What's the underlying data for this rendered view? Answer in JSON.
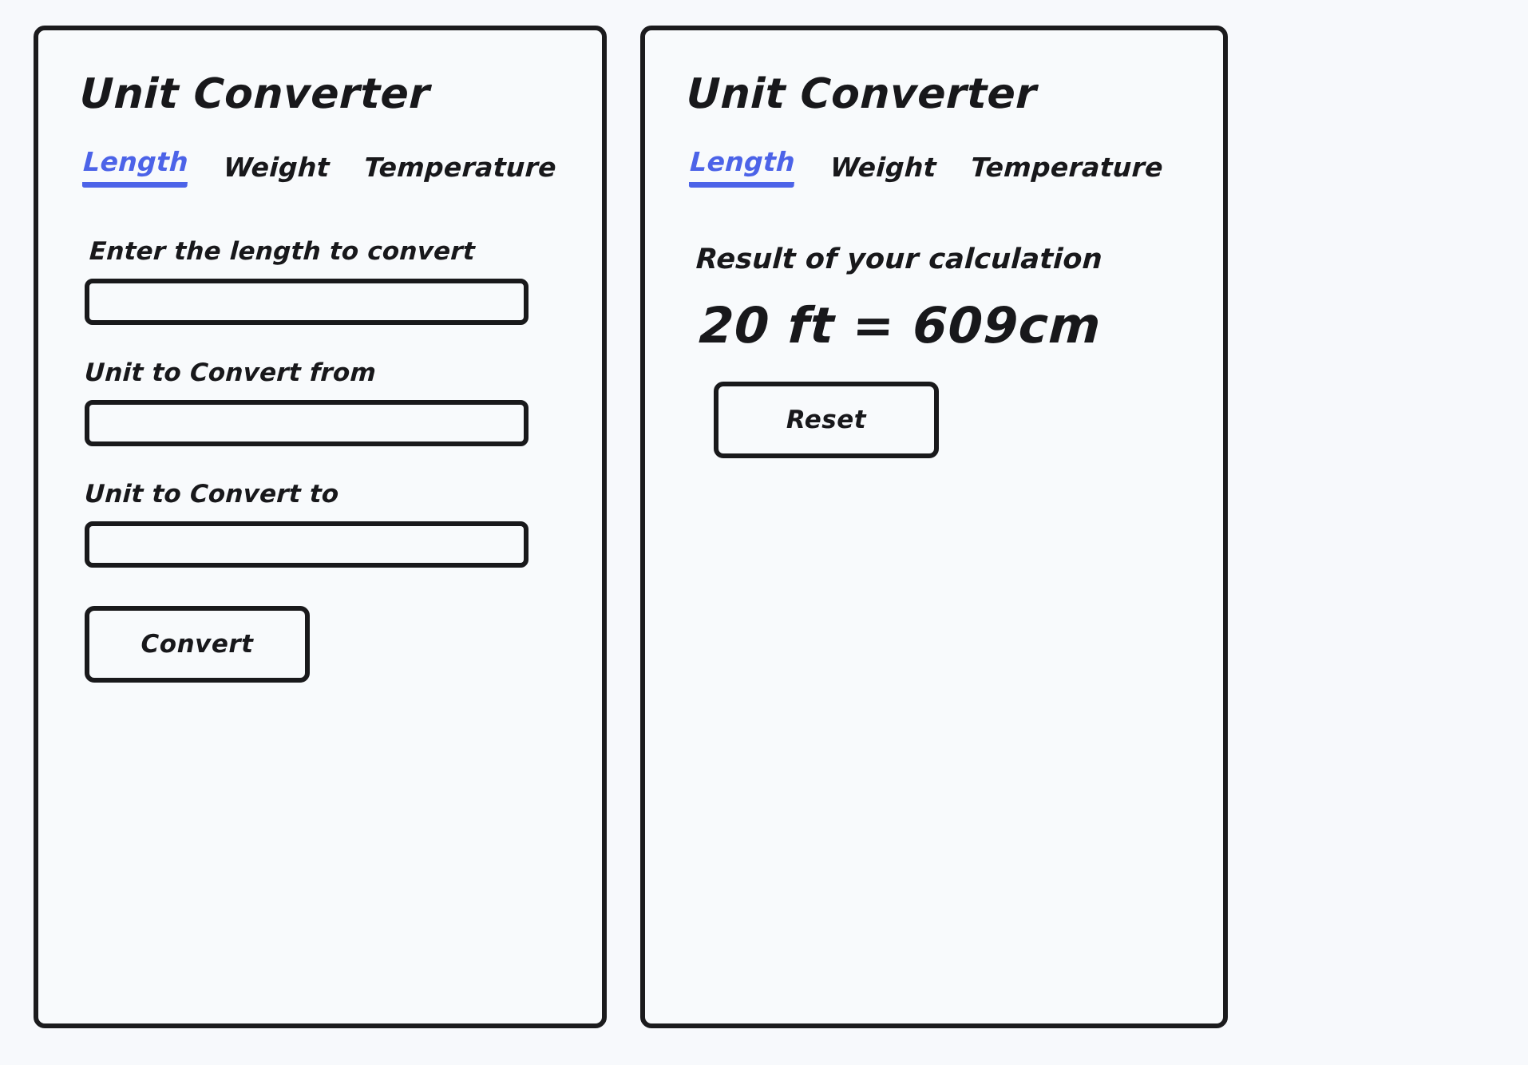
{
  "page": {
    "background_color": "#f7f9fc",
    "accent_color": "#4c63e8",
    "ink_color": "#18181b",
    "panel_fill": "#f8fafc"
  },
  "left_panel": {
    "title": "Unit Converter",
    "tabs": [
      {
        "label": "Length",
        "active": true
      },
      {
        "label": "Weight",
        "active": false
      },
      {
        "label": "Temperature",
        "active": false
      }
    ],
    "fields": [
      {
        "label": "Enter the length to convert",
        "value": "",
        "placeholder": ""
      },
      {
        "label": "Unit to Convert from",
        "value": "",
        "placeholder": ""
      },
      {
        "label": "Unit to Convert to",
        "value": "",
        "placeholder": ""
      }
    ],
    "submit_label": "Convert"
  },
  "right_panel": {
    "title": "Unit Converter",
    "tabs": [
      {
        "label": "Length",
        "active": true
      },
      {
        "label": "Weight",
        "active": false
      },
      {
        "label": "Temperature",
        "active": false
      }
    ],
    "result_caption": "Result of your calculation",
    "result_value": "20 ft = 609cm",
    "reset_label": "Reset"
  }
}
